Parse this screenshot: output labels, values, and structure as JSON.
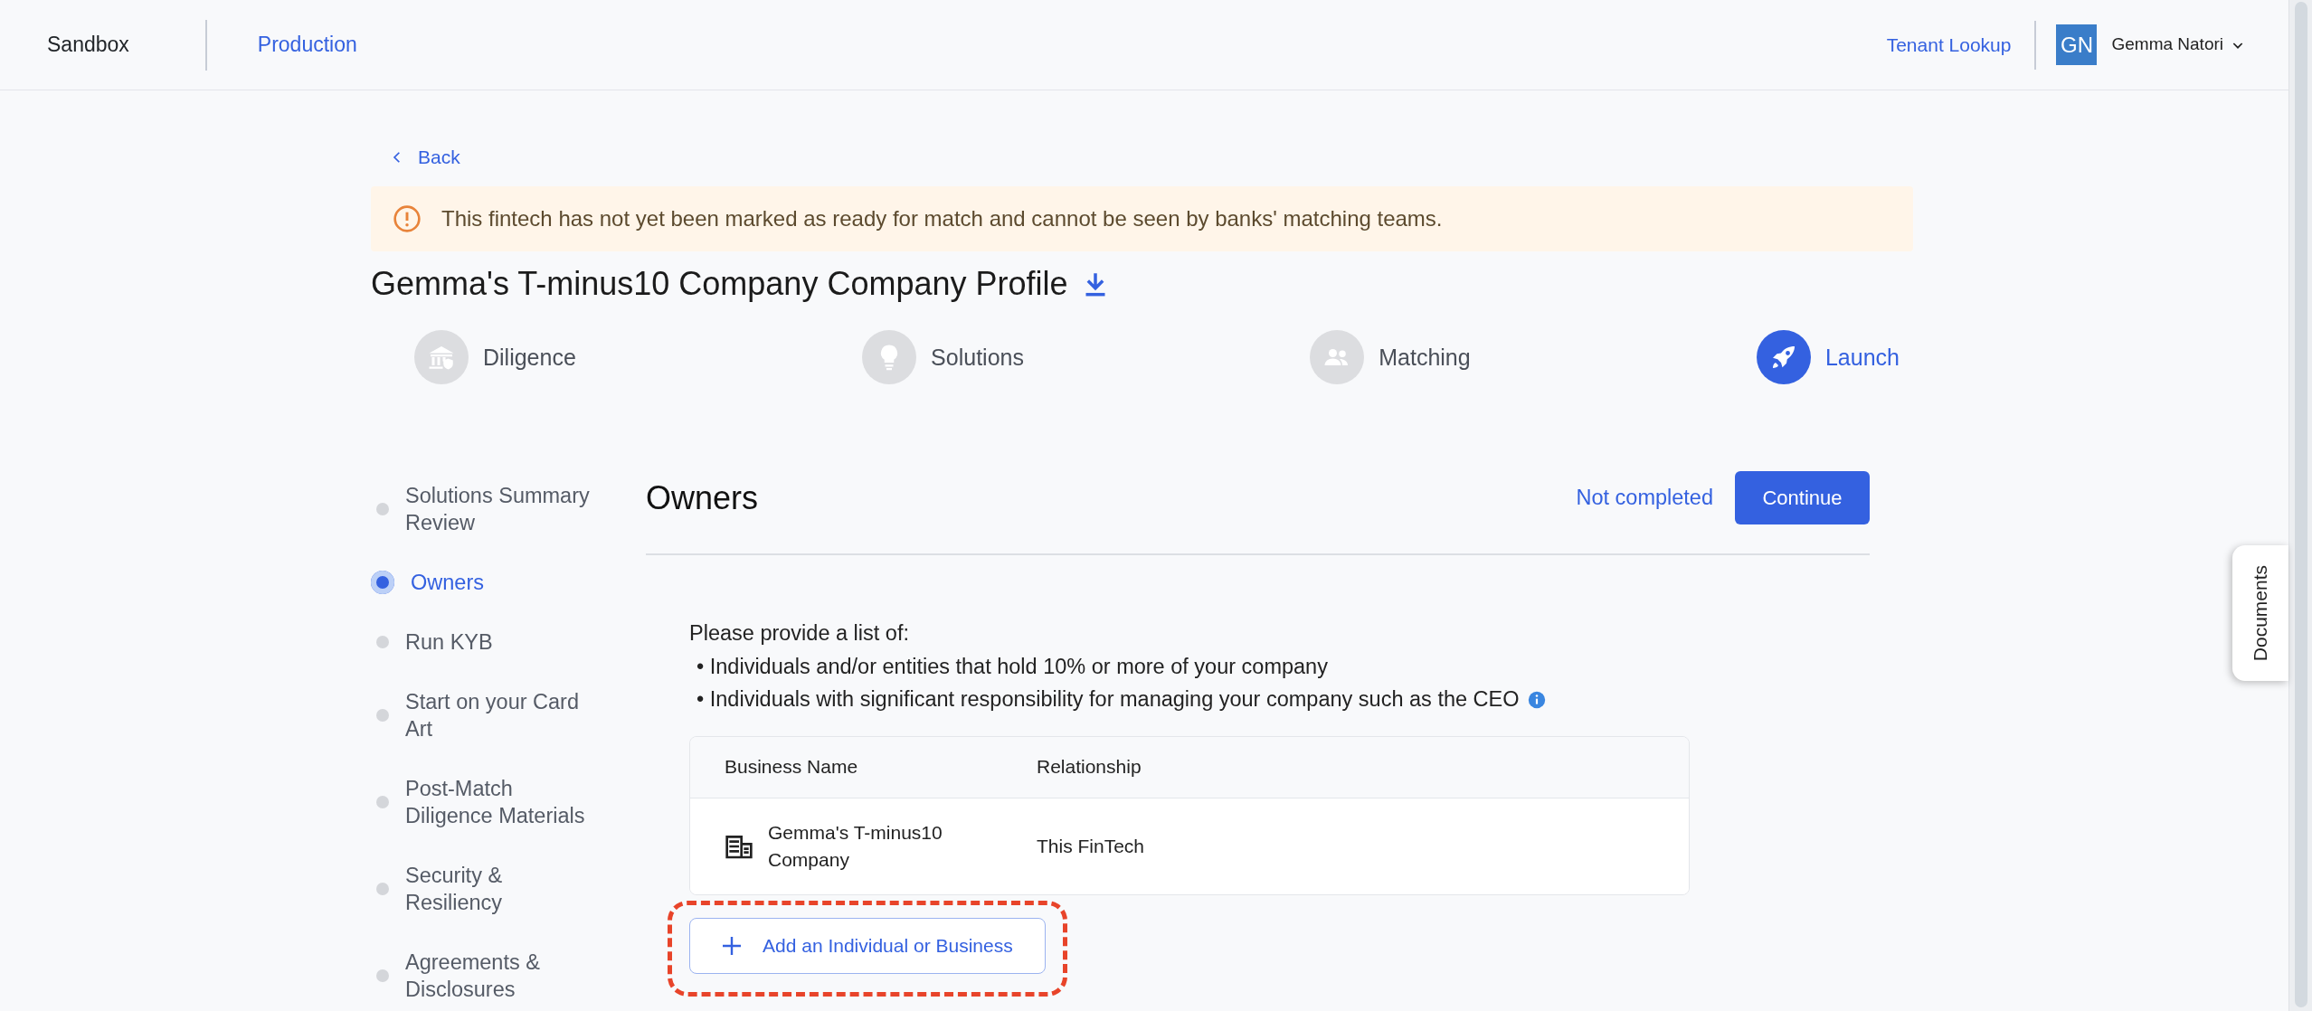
{
  "topbar": {
    "environments": [
      {
        "label": "Sandbox",
        "selected": true
      },
      {
        "label": "Production",
        "selected": false
      }
    ],
    "tenant_lookup": "Tenant Lookup",
    "user": {
      "initials": "GN",
      "name": "Gemma Natori"
    }
  },
  "back": "Back",
  "alert": "This fintech has not yet been marked as ready for match and cannot be seen by banks' matching teams.",
  "title": "Gemma's T-minus10 Company Company Profile",
  "steps": [
    {
      "label": "Diligence",
      "kind": "bank",
      "selected": false
    },
    {
      "label": "Solutions",
      "kind": "bulb",
      "selected": false
    },
    {
      "label": "Matching",
      "kind": "people",
      "selected": false
    },
    {
      "label": "Launch",
      "kind": "rocket",
      "selected": true
    }
  ],
  "sidebar": {
    "items": [
      {
        "label": "Solutions Summary Review",
        "selected": false
      },
      {
        "label": "Owners",
        "selected": true
      },
      {
        "label": "Run KYB",
        "selected": false
      },
      {
        "label": "Start on your Card Art",
        "selected": false
      },
      {
        "label": "Post-Match Diligence Materials",
        "selected": false
      },
      {
        "label": "Security & Resiliency",
        "selected": false
      },
      {
        "label": "Agreements & Disclosures",
        "selected": false
      }
    ]
  },
  "section": {
    "title": "Owners",
    "status": "Not completed",
    "continue_button": "Continue",
    "intro": "Please provide a list of:",
    "bullets": [
      {
        "text": "• Individuals and/or entities that hold 10% or more of your company",
        "info": false
      },
      {
        "text": "• Individuals with significant responsibility for managing your company such as the CEO",
        "info": true
      }
    ],
    "table": {
      "columns": [
        "Business Name",
        "Relationship"
      ],
      "rows": [
        {
          "business_name": "Gemma's T-minus10 Company",
          "relationship": "This FinTech"
        }
      ]
    },
    "add_button": "Add an Individual or Business",
    "add_button_highlighted": true
  },
  "documents_tab": "Documents"
}
